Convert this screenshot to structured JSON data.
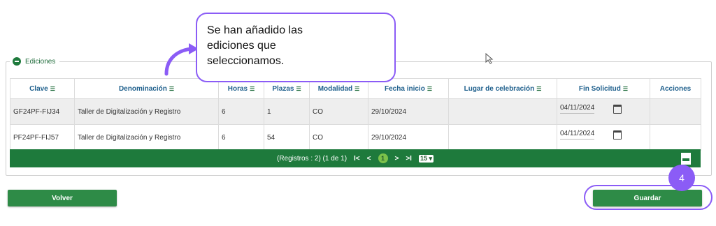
{
  "fieldset": {
    "legend": "Ediciones"
  },
  "table": {
    "headers": [
      "Clave",
      "Denominación",
      "Horas",
      "Plazas",
      "Modalidad",
      "Fecha inicio",
      "Lugar de celebración",
      "Fin Solicitud",
      "Acciones"
    ],
    "rows": [
      {
        "clave": "GF24PF-FIJ34",
        "denominacion": "Taller de Digitalización y Registro",
        "horas": "6",
        "plazas": "1",
        "modalidad": "CO",
        "fecha_inicio": "29/10/2024",
        "lugar": "",
        "fin_solicitud": "04/11/2024"
      },
      {
        "clave": "PF24PF-FIJ57",
        "denominacion": "Taller de Digitalización y Registro",
        "horas": "6",
        "plazas": "54",
        "modalidad": "CO",
        "fecha_inicio": "29/10/2024",
        "lugar": "",
        "fin_solicitud": "04/11/2024"
      }
    ]
  },
  "pager": {
    "summary": "(Registros : 2) (1 de 1)",
    "first": "I<",
    "prev": "<",
    "current_page": "1",
    "next": ">",
    "last": ">I",
    "page_size": "15"
  },
  "buttons": {
    "volver": "Volver",
    "guardar": "Guardar"
  },
  "annotation": {
    "callout_lines": [
      "Se han añadido las",
      "ediciones que",
      "seleccionamos."
    ],
    "step": "4",
    "color": "#8b5cf6"
  },
  "colors": {
    "primary_green": "#1e7a3c",
    "header_text": "#1e5f8c"
  }
}
